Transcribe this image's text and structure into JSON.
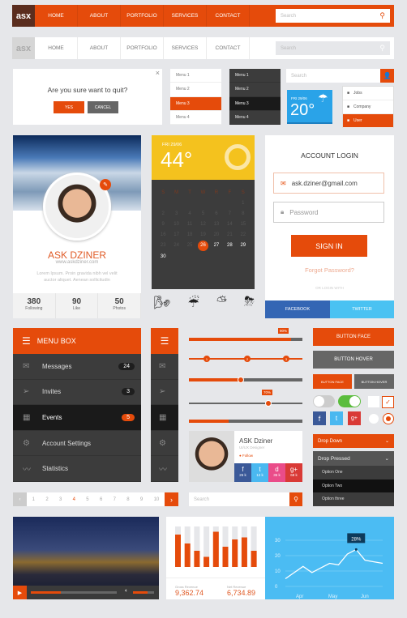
{
  "colors": {
    "accent": "#e54b0b",
    "dark": "#3c3c3c",
    "facebook": "#3b5998",
    "twitter": "#4ab8f0",
    "chart_bg": "#4bbcf3"
  },
  "nav": {
    "logo": "asx",
    "items": [
      "HOME",
      "ABOUT",
      "PORTFOLIO",
      "SERVICES",
      "CONTACT"
    ],
    "search_placeholder": "Search"
  },
  "dialog": {
    "question": "Are you sure want to quit?",
    "yes": "YES",
    "cancel": "CANCEL",
    "close": "×"
  },
  "menus": [
    "Menu 1",
    "Menu 2",
    "Menu 3",
    "Menu 4"
  ],
  "user_search": {
    "placeholder": "Search",
    "dropdown": [
      "Jobs",
      "Company",
      "User"
    ]
  },
  "weather_small": {
    "date": "FRI 29/06",
    "temp": "20°"
  },
  "profile": {
    "name": "ASK DZINER",
    "url": "www.askdziner.com",
    "bio": "Lorem Ipsum. Proin gravida nibh vel velit auctor aliquet. Aenean sollicitudin",
    "stats": [
      {
        "value": "380",
        "label": "Following"
      },
      {
        "value": "90",
        "label": "Like"
      },
      {
        "value": "50",
        "label": "Photos"
      }
    ]
  },
  "weather_big": {
    "date": "FRI 29/06",
    "temp": "44°",
    "weekdays": [
      "S",
      "M",
      "T",
      "W",
      "R",
      "F",
      "S"
    ],
    "month_start_offset": 6,
    "days_in_month": 30,
    "selected_day": 26,
    "weather_icons": [
      "wind-sun-icon",
      "rain-icon",
      "sun-rain-icon",
      "thunder-icon"
    ]
  },
  "login": {
    "title": "ACCOUNT LOGIN",
    "email": "ask.dziner@gmail.com",
    "password_placeholder": "Password",
    "sign_in": "SIGN IN",
    "forgot": "Forgot Password?",
    "or": "OR LOGIN WITH",
    "facebook": "FACEBOOK",
    "twitter": "TWITTER"
  },
  "menu_box": {
    "title": "MENU BOX",
    "items": [
      {
        "label": "Messages",
        "icon": "mail-icon",
        "badge": "24"
      },
      {
        "label": "Invites",
        "icon": "send-icon",
        "badge": "3"
      },
      {
        "label": "Events",
        "icon": "calendar-icon",
        "badge": "5",
        "active": true
      },
      {
        "label": "Account Settings",
        "icon": "gear-icon"
      },
      {
        "label": "Statistics",
        "icon": "chart-icon"
      }
    ]
  },
  "sliders": {
    "progress1": 90,
    "progress1_label": "90%",
    "steps": [
      "1",
      "2",
      "3"
    ],
    "slider2": 46,
    "slider3": 70,
    "slider3_label": "70%",
    "progress4": 35
  },
  "mini_profile": {
    "name": "ASK Dziner",
    "role": "UI/UX Designer",
    "follow": "Follow",
    "social": [
      {
        "icon": "f",
        "count": "26 k",
        "color": "#3b5998"
      },
      {
        "icon": "t",
        "count": "12 k",
        "color": "#4ab8f0"
      },
      {
        "icon": "d",
        "count": "35 k",
        "color": "#ea4c89"
      },
      {
        "icon": "g+",
        "count": "68 k",
        "color": "#d93a36"
      }
    ]
  },
  "buttons": {
    "face": "BUTTON FACE",
    "hover": "BUTTON HOVER",
    "small_face": "BUTTON FACE",
    "small_hover": "BUTTON HOVER"
  },
  "toggles": {
    "off": false,
    "on": true,
    "checkbox1": false,
    "checkbox2": true,
    "radio1": false,
    "radio2": true
  },
  "dropdowns": {
    "drop_down": "Drop Down",
    "drop_pressed": "Drop Pressed",
    "options": [
      "Option One",
      "Option Two",
      "Option three"
    ],
    "selected": "Option Two"
  },
  "pagination": {
    "pages": [
      "1",
      "2",
      "3",
      "4",
      "5",
      "6",
      "7",
      "8",
      "9",
      "10"
    ],
    "current": "4"
  },
  "search2": {
    "placeholder": "Search"
  },
  "video": {
    "progress": 35,
    "volume": 70
  },
  "revenue": {
    "gross_label": "Gross Revenue",
    "gross": "9,362.74",
    "net_label": "Net Revenue",
    "net": "6,734.89"
  },
  "chart_data": [
    {
      "type": "bar",
      "values": [
        80,
        58,
        40,
        25,
        87,
        50,
        68,
        73,
        40
      ],
      "ylim": [
        0,
        100
      ]
    },
    {
      "type": "line",
      "x_ticks": [
        "Apr",
        "May",
        "Jun"
      ],
      "y_ticks": [
        "0",
        "10",
        "20",
        "30"
      ],
      "ylim": [
        0,
        30
      ],
      "values": [
        5,
        9,
        13,
        9,
        12,
        15,
        14,
        21,
        24,
        17,
        16,
        15
      ],
      "annotation": "28%"
    }
  ]
}
